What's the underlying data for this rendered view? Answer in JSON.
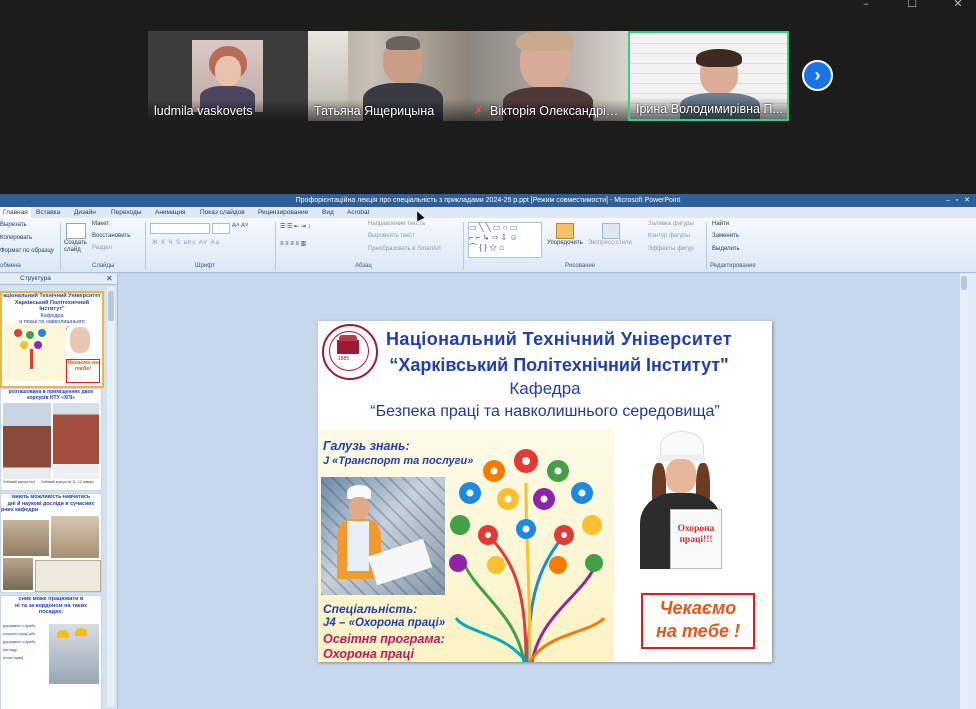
{
  "window_controls": {
    "minimize": "–",
    "maximize": "☐",
    "close": "✕"
  },
  "participants": [
    {
      "name": "ludmila vaskovets",
      "muted": false
    },
    {
      "name": "Татьяна Ящерицына",
      "muted": false
    },
    {
      "name": "Вікторія Олександрівна",
      "muted": true
    },
    {
      "name": "Ірина Володимирівна П...",
      "muted": false,
      "active_speaker": true
    }
  ],
  "next_button": "›",
  "ppt": {
    "title": "Профорієнтаційна лекція про  спеціальність з прикладами 2024-25 р.ppt [Режим совместимости] - Microsoft PowerPoint",
    "menu": [
      "Главная",
      "Вставка",
      "Дизайн",
      "Переходы",
      "Анимация",
      "Показ слайдов",
      "Рецензирование",
      "Вид",
      "Acrobat"
    ],
    "ribbon": {
      "clipboard": {
        "cut": "Вырезать",
        "copy": "Копировать",
        "format": "Формат по образцу",
        "label": "обмена"
      },
      "slides": {
        "create": "Создать слайд",
        "layout": "Макет",
        "reset": "Восстановить",
        "section": "Раздел",
        "label": "Слайды"
      },
      "font": {
        "label": "Шрифт",
        "buttons": "Ж  К  Ч  S  abc  AV  Aa"
      },
      "paragraph": {
        "direction": "Направление текста",
        "align": "Выровнять текст",
        "smartart": "Преобразовать в SmartArt",
        "label": "Абзац"
      },
      "drawing": {
        "arrange": "Упорядочить",
        "styles": "Экспресс-стили",
        "fill": "Заливка фигуры",
        "outline": "Контур фигуры",
        "effects": "Эффекты фигур",
        "label": "Рисование"
      },
      "editing": {
        "find": "Найти",
        "replace": "Заменить",
        "select": "Выделить",
        "label": "Редактирование"
      }
    },
    "pane_tab": "Структура",
    "thumbnails": [
      {
        "line1": "аціональний Технічний Університет",
        "line2": "Харківський Політехнічний Інститут\"",
        "line3": "Кафедра",
        "line4": "а праці та навколишнього середовища\"",
        "badge": "Чекаємо на тебе!"
      },
      {
        "line1": "розташована в приміщеннях двох",
        "line2": "корпусів НТУ «ХПІ»",
        "footer1": "Учбовий корпус №1",
        "footer2": "Учбовий корпус № 11, 12 поверх"
      },
      {
        "line1": "мають можливість навчатись",
        "line2": "дні й наукові досліди в сучасних",
        "line3": "рних кафедри"
      },
      {
        "line1": "сник може працювати в",
        "line2": "ні та за кордоном на таких",
        "line3": "посадах:",
        "items": [
          "державної служби",
          "охорони праці або",
          "державної служби",
          "нагляду",
          "атних праці"
        ]
      }
    ]
  },
  "slide": {
    "title1": "Національний  Технічний  Університет",
    "title2": "“Харківський Політехнічний Інститут\"",
    "dept": "Кафедра",
    "dept_name": "“Безпека праці та навколишнього середовища”",
    "field_label": "Галузь знань:",
    "field_value": "J «Транспорт та послуги»",
    "spec_label": "Спеціальність:",
    "spec_value": "J4 – «Охорона праці»",
    "program_label": "Освітня програма:",
    "program_value": "Охорона праці",
    "sign_text": "Охорона праці!!!",
    "cta_line1": "Чекаємо",
    "cta_line2": "на тебе !",
    "seal_year": "1885"
  },
  "colors": {
    "accent_blue": "#1f3fb0",
    "title_bar": "#2d5f9b",
    "active_speaker": "#35d07f",
    "cta_red": "#e02020",
    "cta_text": "#e8561a",
    "next_button": "#1a73e8"
  }
}
